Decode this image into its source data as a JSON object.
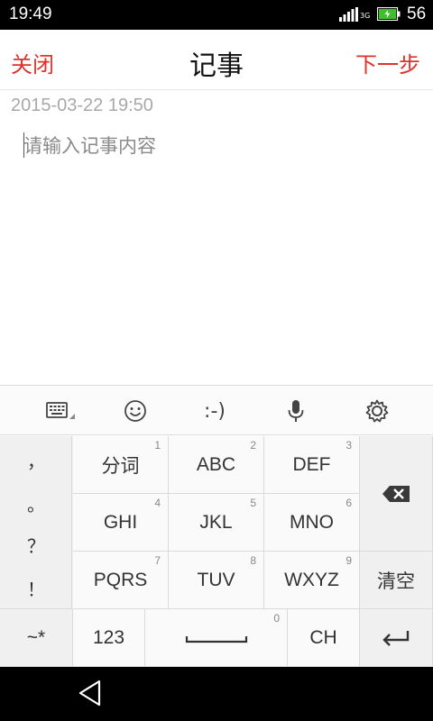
{
  "status_bar": {
    "time": "19:49",
    "network": "3G",
    "battery_level": "56",
    "icons": [
      "signal-icon",
      "battery-charging-icon"
    ]
  },
  "header": {
    "close_label": "关闭",
    "title": "记事",
    "next_label": "下一步",
    "accent_color": "#e0312a"
  },
  "note": {
    "timestamp": "2015-03-22 19:50",
    "placeholder": "请输入记事内容",
    "value": ""
  },
  "keyboard_toolbar": {
    "items": [
      {
        "name": "keyboard-switch-icon"
      },
      {
        "name": "emoji-icon"
      },
      {
        "name": "emoticon-button",
        "label": ":-)"
      },
      {
        "name": "microphone-icon"
      },
      {
        "name": "settings-gear-icon"
      }
    ]
  },
  "keyboard": {
    "punctuation": [
      "，",
      "。",
      "？",
      "！"
    ],
    "keys": [
      {
        "label": "分词",
        "num": "1"
      },
      {
        "label": "ABC",
        "num": "2"
      },
      {
        "label": "DEF",
        "num": "3"
      },
      {
        "label": "GHI",
        "num": "4"
      },
      {
        "label": "JKL",
        "num": "5"
      },
      {
        "label": "MNO",
        "num": "6"
      },
      {
        "label": "PQRS",
        "num": "7"
      },
      {
        "label": "TUV",
        "num": "8"
      },
      {
        "label": "WXYZ",
        "num": "9"
      }
    ],
    "backspace_icon": "backspace-icon",
    "clear_label": "清空",
    "symbols_label": "~*",
    "numbers_label": "123",
    "space_num": "0",
    "lang_label": "CH",
    "enter_icon": "enter-icon"
  },
  "nav_bar": {
    "icons": [
      "back-icon"
    ]
  }
}
